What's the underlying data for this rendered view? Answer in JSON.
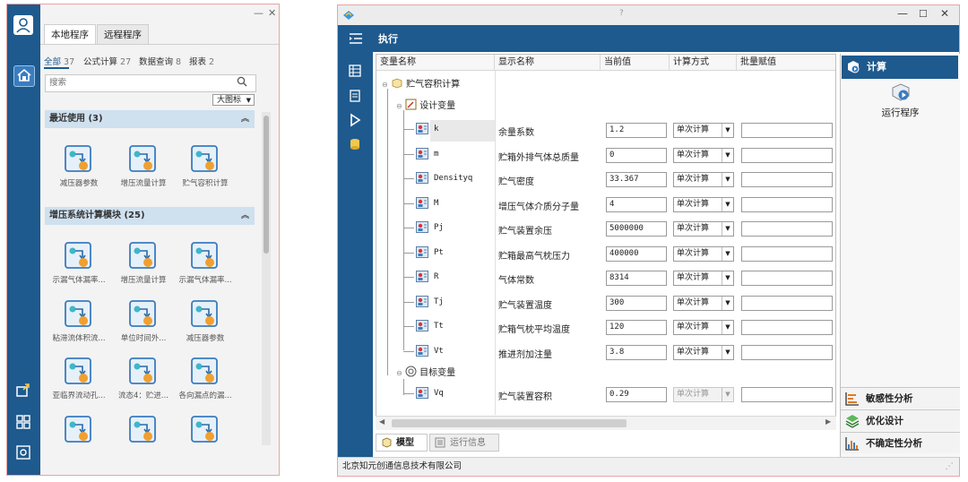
{
  "left": {
    "tabs": [
      "本地程序",
      "远程程序"
    ],
    "filters": [
      {
        "label": "全部",
        "count": "37"
      },
      {
        "label": "公式计算",
        "count": "27"
      },
      {
        "label": "数据查询",
        "count": "8"
      },
      {
        "label": "报表",
        "count": "2"
      }
    ],
    "search_placeholder": "搜索",
    "view_mode": "大图标",
    "recent": {
      "title": "最近使用 (3)",
      "items": [
        "减压器参数",
        "增压流量计算",
        "贮气容积计算"
      ]
    },
    "module": {
      "title": "增压系统计算模块 (25)",
      "items": [
        "示漏气体漏率...",
        "增压流量计算",
        "示漏气体漏率...",
        "粘滞流体积流...",
        "单位时间外...",
        "减压器参数",
        "亚临界流动孔...",
        "流态4：贮进...",
        "各向漏点的漏..."
      ]
    }
  },
  "right": {
    "window_title": "?",
    "toolbar_label": "执行",
    "columns": [
      "变量名称",
      "显示名称",
      "当前值",
      "计算方式",
      "批量赋值"
    ],
    "root": "贮气容积计算",
    "design_group": "设计变量",
    "target_group": "目标变量",
    "rows": [
      {
        "name": "k",
        "display": "余量系数",
        "value": "1.2",
        "mode": "单次计算"
      },
      {
        "name": "m",
        "display": "贮箱外排气体总质量",
        "value": "0",
        "mode": "单次计算"
      },
      {
        "name": "Densityq",
        "display": "贮气密度",
        "value": "33.367",
        "mode": "单次计算"
      },
      {
        "name": "M",
        "display": "增压气体介质分子量",
        "value": "4",
        "mode": "单次计算"
      },
      {
        "name": "Pj",
        "display": "贮气装置余压",
        "value": "5000000",
        "mode": "单次计算"
      },
      {
        "name": "Pt",
        "display": "贮箱最高气枕压力",
        "value": "400000",
        "mode": "单次计算"
      },
      {
        "name": "R",
        "display": "气体常数",
        "value": "8314",
        "mode": "单次计算"
      },
      {
        "name": "Tj",
        "display": "贮气装置温度",
        "value": "300",
        "mode": "单次计算"
      },
      {
        "name": "Tt",
        "display": "贮箱气枕平均温度",
        "value": "120",
        "mode": "单次计算"
      },
      {
        "name": "Vt",
        "display": "推进剂加注量",
        "value": "3.8",
        "mode": "单次计算"
      }
    ],
    "target_row": {
      "name": "Vq",
      "display": "贮气装置容积",
      "value": "0.29",
      "mode": "单次计算"
    },
    "bottom_tabs": [
      "模型",
      "运行信息"
    ],
    "side": {
      "header": "计算",
      "run_label": "运行程序",
      "buttons": [
        "敏感性分析",
        "优化设计",
        "不确定性分析"
      ]
    },
    "status": "北京知元创通信息技术有限公司"
  }
}
